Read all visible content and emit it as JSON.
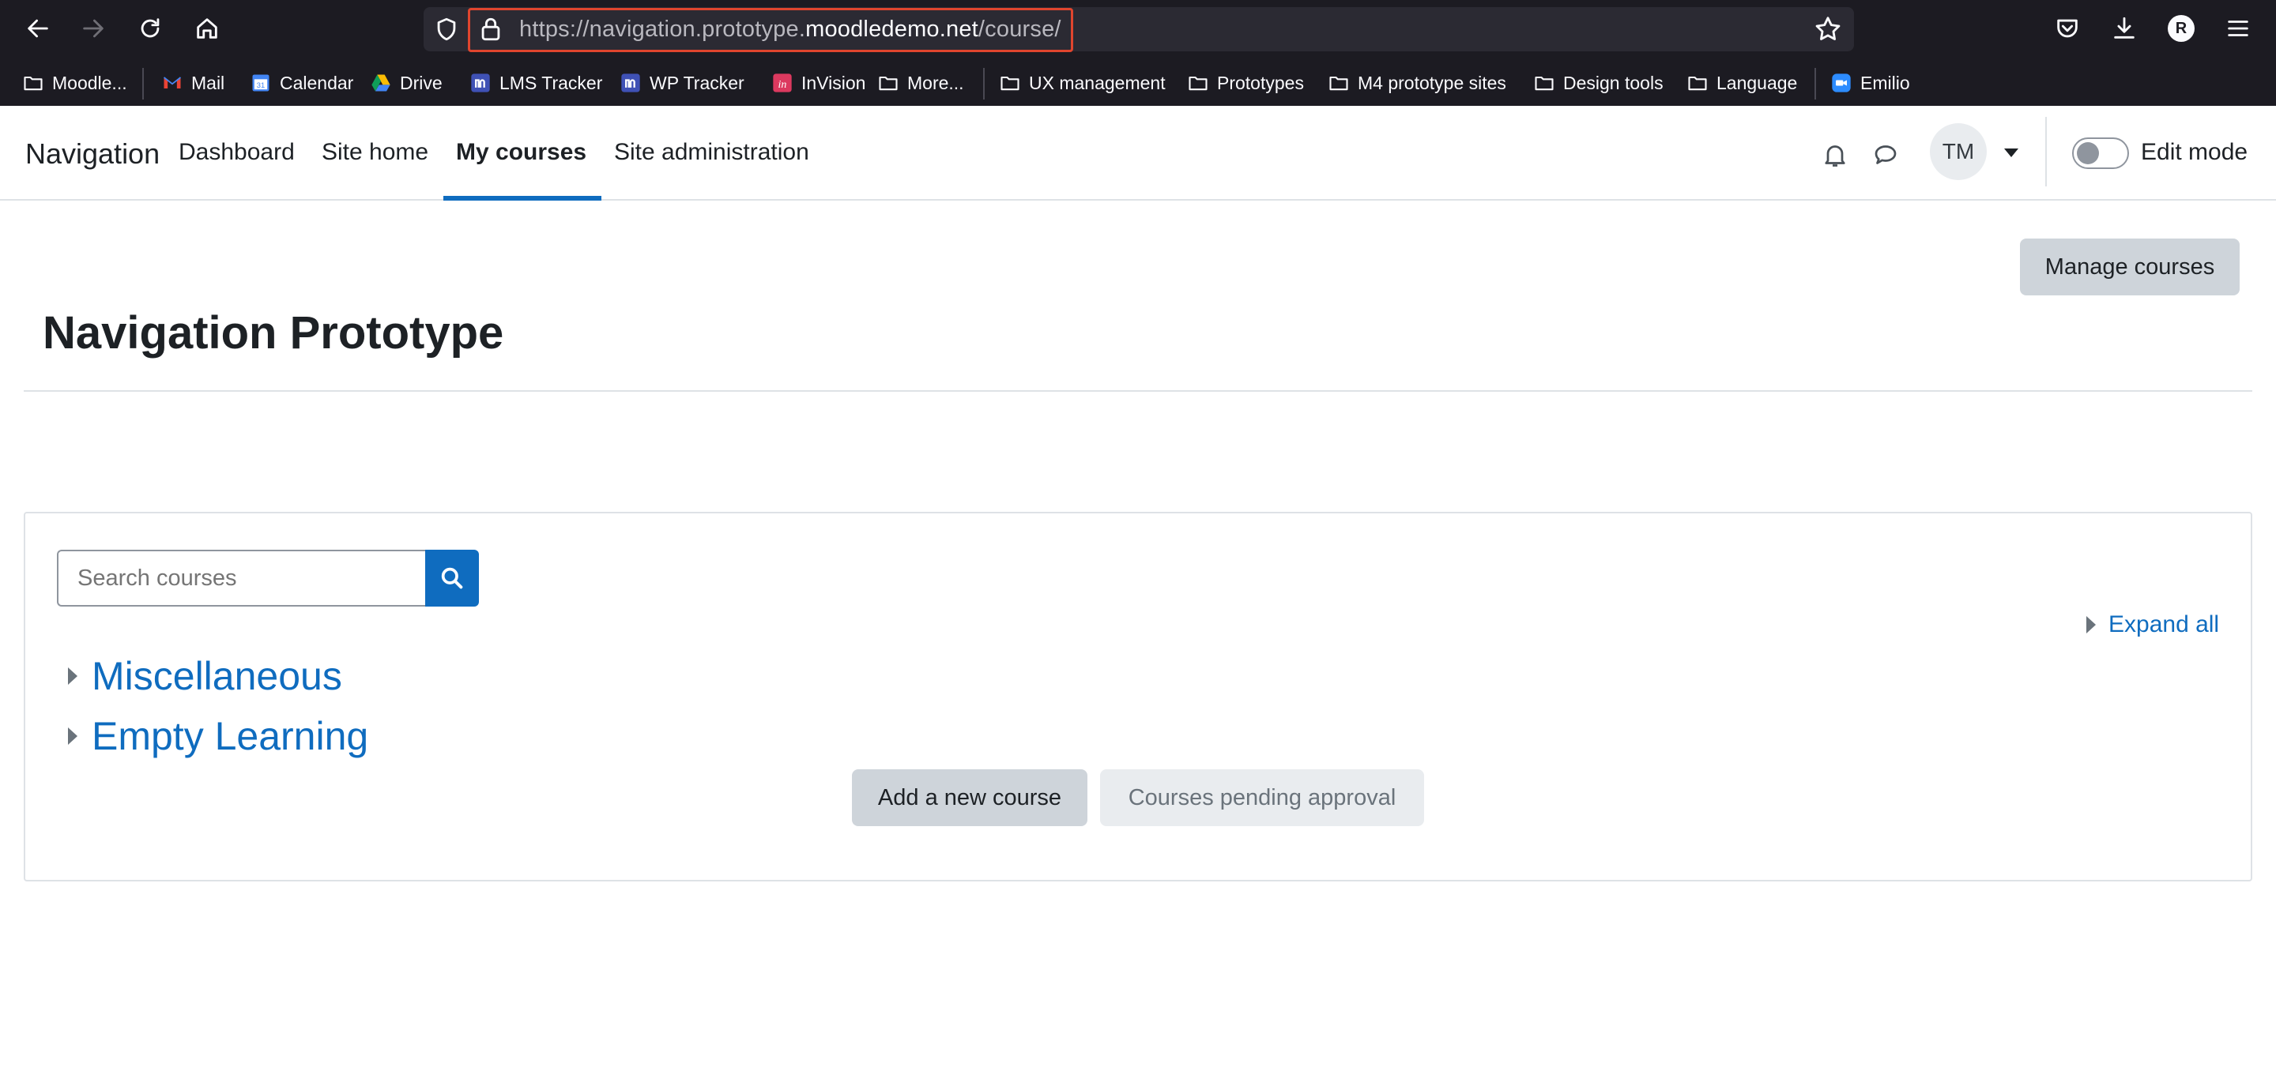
{
  "browser": {
    "url_prefix": "https://navigation.prototype.",
    "url_host": "moodledemo.net",
    "url_suffix": "/course/",
    "profile_initial": "R",
    "bookmarks": [
      {
        "label": "Moodle...",
        "icon": "folder-icon"
      },
      {
        "label": "Mail",
        "icon": "gmail-icon"
      },
      {
        "label": "Calendar",
        "icon": "calendar-icon"
      },
      {
        "label": "Drive",
        "icon": "drive-icon"
      },
      {
        "label": "LMS Tracker",
        "icon": "tracker-icon"
      },
      {
        "label": "WP Tracker",
        "icon": "tracker-icon"
      },
      {
        "label": "InVision",
        "icon": "invision-icon"
      },
      {
        "label": "More...",
        "icon": "folder-icon"
      },
      {
        "label": "UX management",
        "icon": "folder-icon"
      },
      {
        "label": "Prototypes",
        "icon": "folder-icon"
      },
      {
        "label": "M4 prototype sites",
        "icon": "folder-icon"
      },
      {
        "label": "Design tools",
        "icon": "folder-icon"
      },
      {
        "label": "Language",
        "icon": "folder-icon"
      },
      {
        "label": "Emilio",
        "icon": "zoom-icon"
      }
    ],
    "colors": {
      "chrome": "#1c1b22",
      "url_highlight": "#e0452e"
    }
  },
  "navbar": {
    "brand": "Navigation",
    "links": [
      {
        "label": "Dashboard",
        "active": false
      },
      {
        "label": "Site home",
        "active": false
      },
      {
        "label": "My courses",
        "active": true
      },
      {
        "label": "Site administration",
        "active": false
      }
    ],
    "avatar_initials": "TM",
    "edit_mode_label": "Edit mode",
    "edit_mode_on": false
  },
  "page": {
    "title": "Navigation Prototype",
    "manage_courses": "Manage courses",
    "search_placeholder": "Search courses",
    "expand_all": "Expand all",
    "categories": [
      "Miscellaneous",
      "Empty Learning"
    ],
    "add_course": "Add a new course",
    "pending_approval": "Courses pending approval",
    "colors": {
      "primary": "#0f6cbf",
      "secondary": "#ced4da"
    }
  }
}
